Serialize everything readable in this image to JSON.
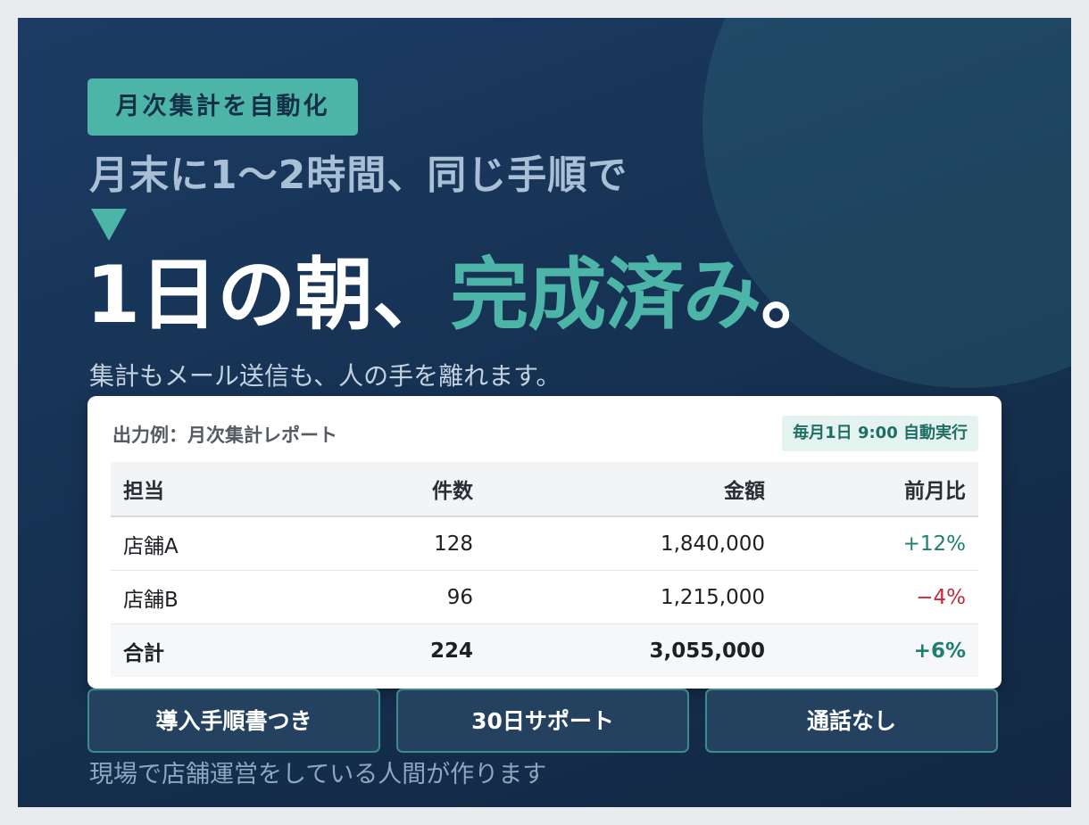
{
  "badge": "月次集計を自動化",
  "lead": "月末に1〜2時間、同じ手順で",
  "headline": {
    "part1": "1日の朝、",
    "accent": "完成済み",
    "part2": "。"
  },
  "subline": "集計もメール送信も、人の手を離れます。",
  "card": {
    "title": "出力例：月次集計レポート",
    "schedule": "毎月1日 9:00 自動実行",
    "columns": [
      "担当",
      "件数",
      "金額",
      "前月比"
    ],
    "rows": [
      {
        "name": "店舗A",
        "count": "128",
        "amount": "1,840,000",
        "ratio": "+12%"
      },
      {
        "name": "店舗B",
        "count": "96",
        "amount": "1,215,000",
        "ratio": "−4%"
      },
      {
        "name": "合計",
        "count": "224",
        "amount": "3,055,000",
        "ratio": "+6%"
      }
    ]
  },
  "features": [
    "導入手順書つき",
    "30日サポート",
    "通話なし"
  ],
  "footer": "現場で店舗運営をしている人間が作ります",
  "colors": {
    "accent": "#4db5a7",
    "background": "#163253",
    "positive": "#1f7f6f",
    "negative": "#c6283a"
  }
}
